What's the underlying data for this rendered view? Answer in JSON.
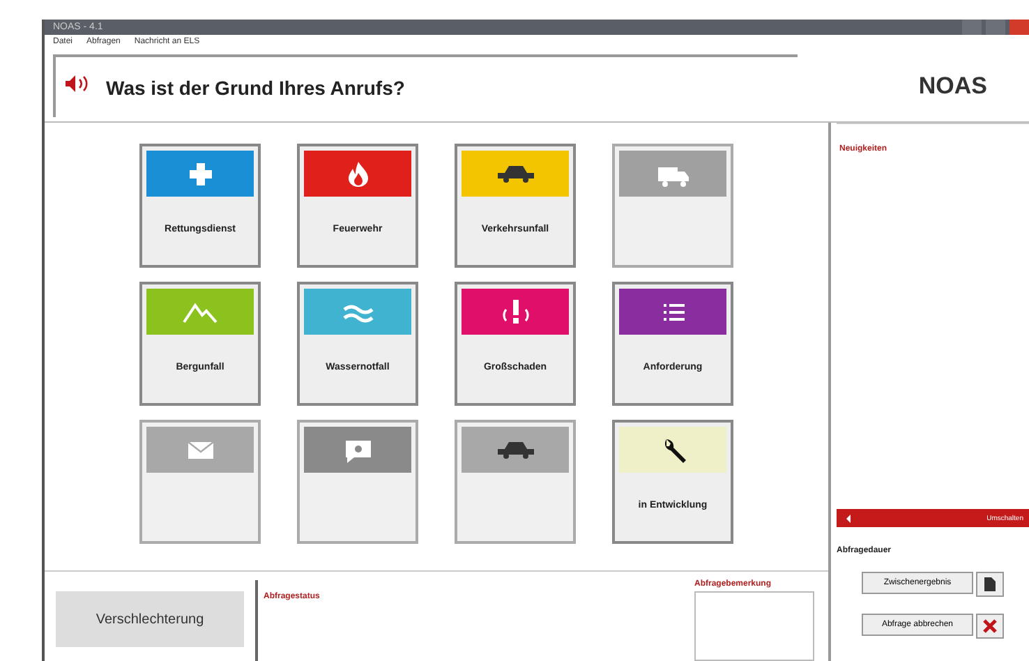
{
  "window": {
    "title": "NOAS - 4.1"
  },
  "menu": [
    "Datei",
    "Abfragen",
    "Nachricht an ELS"
  ],
  "header": {
    "question": "Was ist der Grund Ihres Anrufs?",
    "logo": "NOAS"
  },
  "tiles": [
    {
      "label": "Rettungsdienst",
      "kind": "cross",
      "color": "#1a8fd6",
      "disabled": false
    },
    {
      "label": "Feuerwehr",
      "kind": "flame",
      "color": "#e0201a",
      "disabled": false
    },
    {
      "label": "Verkehrsunfall",
      "kind": "car",
      "color": "#f2c500",
      "disabled": false
    },
    {
      "kind": "truck",
      "color": "#a0a0a0",
      "disabled": true
    },
    {
      "label": "Bergunfall",
      "kind": "mountain",
      "color": "#8cc21e",
      "disabled": false
    },
    {
      "label": "Wassernotfall",
      "kind": "waves",
      "color": "#3fb3cf",
      "disabled": false
    },
    {
      "label": "Großschaden",
      "kind": "alert",
      "color": "#e0106a",
      "disabled": false
    },
    {
      "label": "Anforderung",
      "kind": "list",
      "color": "#8a2d9e",
      "disabled": false
    },
    {
      "kind": "mail",
      "color": "#a8a8a8",
      "disabled": true
    },
    {
      "kind": "question",
      "color": "#8a8a8a",
      "disabled": true
    },
    {
      "kind": "car",
      "color": "#a8a8a8",
      "disabled": true
    },
    {
      "label": "in Entwicklung",
      "kind": "wrench",
      "color": "#f0f0c8",
      "disabled": false
    }
  ],
  "side": {
    "heading": "Neuigkeiten",
    "bar": "Umschalten",
    "duration_label": "Abfragedauer",
    "buttons": [
      {
        "label": "Zwischenergebnis",
        "kind": "doc"
      },
      {
        "label": "Abfrage abbrechen",
        "kind": "cancel"
      }
    ]
  },
  "bottom": {
    "button": "Verschlechterung",
    "status_label": "Abfragestatus",
    "note_label": "Abfragebemerkung"
  }
}
